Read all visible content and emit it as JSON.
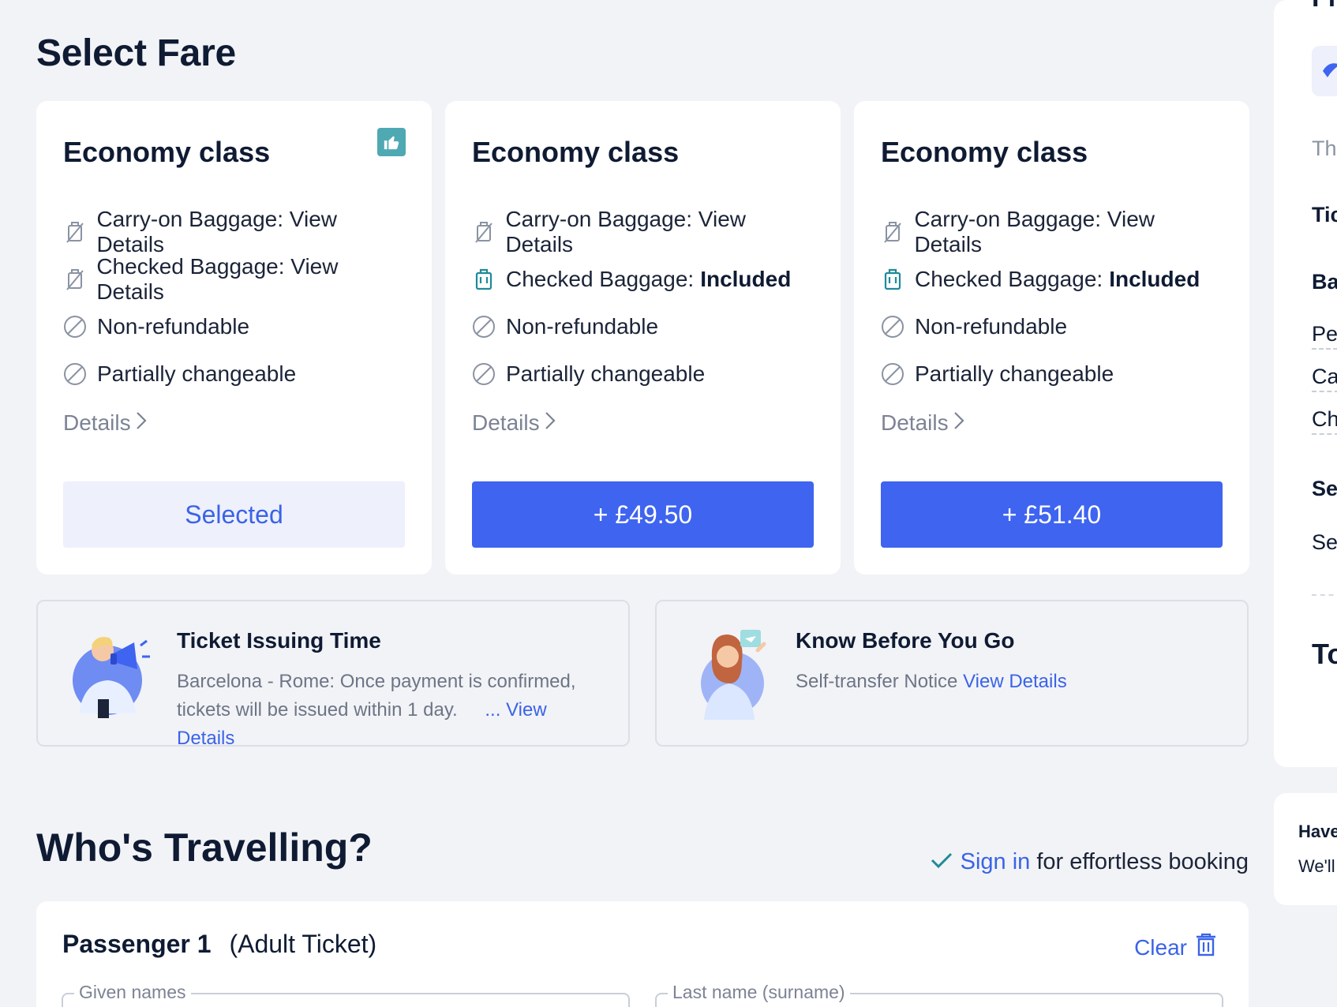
{
  "header": {
    "title": "Select Fare"
  },
  "fares": [
    {
      "title": "Economy class",
      "recommended_icon": "thumbs-up-icon",
      "carry_on_label": "Carry-on Baggage: View Details",
      "checked_label": "Checked Baggage: View Details",
      "checked_value": "",
      "refund": "Non-refundable",
      "change": "Partially changeable",
      "details": "Details",
      "button": "Selected"
    },
    {
      "title": "Economy class",
      "carry_on_label": "Carry-on Baggage: View Details",
      "checked_label": "Checked Baggage:",
      "checked_value": "Included",
      "refund": "Non-refundable",
      "change": "Partially changeable",
      "details": "Details",
      "button": "+ £49.50"
    },
    {
      "title": "Economy class",
      "carry_on_label": "Carry-on Baggage: View Details",
      "checked_label": "Checked Baggage:",
      "checked_value": "Included",
      "refund": "Non-refundable",
      "change": "Partially changeable",
      "details": "Details",
      "button": "+ £51.40"
    }
  ],
  "info": {
    "ticket": {
      "title": "Ticket Issuing Time",
      "text_line1": "Barcelona - Rome: Once payment is confirmed,",
      "text_line2": "tickets will be issued within 1 day.",
      "link": "... View Details"
    },
    "know": {
      "title": "Know Before You Go",
      "text": "Self-transfer Notice",
      "link": "View Details"
    }
  },
  "travellers": {
    "title": "Who's Travelling?",
    "signin_link": "Sign in",
    "signin_text": "for effortless booking",
    "passenger": {
      "label": "Passenger 1",
      "type": "(Adult Ticket)",
      "clear": "Clear",
      "given_names": "Given names",
      "last_name": "Last name (surname)"
    }
  },
  "sidebar": {
    "top_partial": "Fl",
    "line1": "Th",
    "line2": "Tic",
    "line3": "Ba",
    "line4": "Pe",
    "line5": "Ca",
    "line6": "Ch",
    "line7": "Se",
    "line8": "Se",
    "line9": "To",
    "box_line1": "Have",
    "box_line2": "We'll"
  },
  "colors": {
    "accent": "#3e64f0",
    "teal": "#4fa9b3",
    "text": "#0f1b33"
  }
}
